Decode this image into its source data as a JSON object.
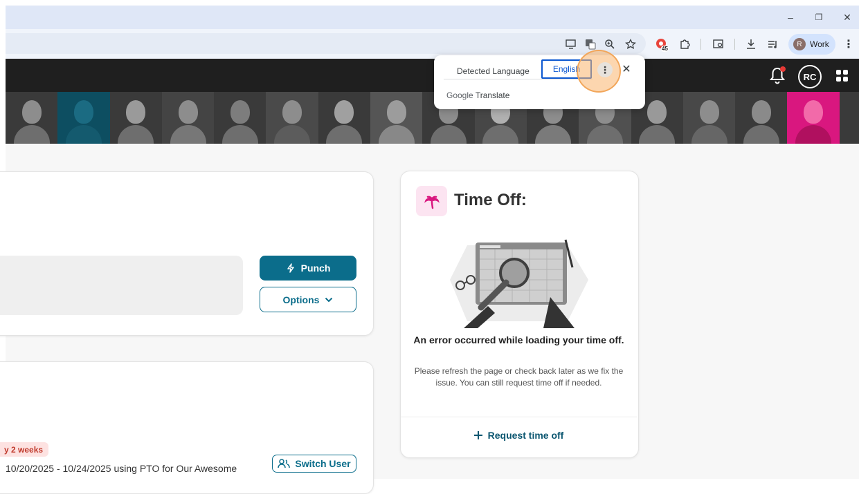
{
  "browser": {
    "profile_label": "Work",
    "profile_initial": "R",
    "badge_count": "45",
    "win_minimize": "–",
    "win_restore": "❐",
    "win_close": "✕"
  },
  "translate_popup": {
    "tab_detected": "Detected Language",
    "tab_target": "English",
    "more_glyph": "⋮",
    "close_glyph": "✕",
    "brand_google": "Google",
    "brand_translate": "Translate"
  },
  "header": {
    "avatar_initials": "RC"
  },
  "punch_card": {
    "punch_label": "Punch",
    "options_label": "Options"
  },
  "pto_card": {
    "badge_text": "y 2 weeks",
    "pto_text": "10/20/2025 - 10/24/2025 using PTO for Our Awesome",
    "switch_user_label": "Switch User"
  },
  "time_off_card": {
    "title": "Time Off:",
    "error_title": "An error occurred while loading your time off.",
    "error_desc": "Please refresh the page or check back later as we fix the issue. You can still request time off if needed.",
    "request_label": "Request time off"
  },
  "colors": {
    "accent": "#0b6d8b",
    "brand_pink": "#d9177f",
    "header_bg": "#1f1f1f",
    "highlight": "#f2a65a"
  }
}
